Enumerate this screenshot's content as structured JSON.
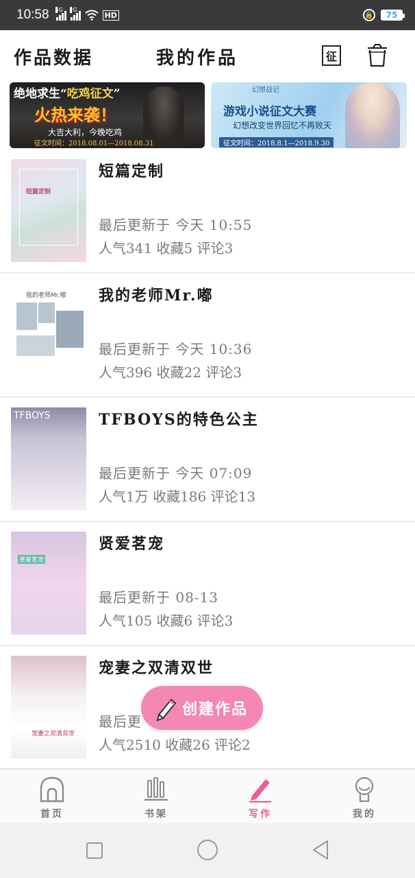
{
  "status_bar": {
    "time": "10:58",
    "net1": "4G",
    "net2": "2G",
    "hd": "HD",
    "battery": "75"
  },
  "header": {
    "left_label": "作品数据",
    "title": "我的作品",
    "contest_button": "征",
    "trash_icon": "trash-icon"
  },
  "banners": [
    {
      "headline_a": "绝地求生“",
      "headline_b": "吃鸡征文",
      "headline_c": "”",
      "big": "火热来袭！",
      "slogan": "大吉大利，今晚吃鸡",
      "date": "征文时间：2018.08.01—2018.08.31"
    },
    {
      "logo": "幻想战记",
      "title": "游戏小说征文大赛",
      "subtitle": "幻想改变世界回忆不再败天",
      "date": "征文时间：2018.8.1—2018.9.30"
    }
  ],
  "works": [
    {
      "title": "短篇定制",
      "updated": "最后更新于 今天 10:55",
      "stats": "人气341 收藏5 评论3",
      "cover_text": "短篇定制"
    },
    {
      "title": "我的老师Mr.嘟",
      "updated": "最后更新于 今天 10:36",
      "stats": "人气396 收藏22 评论3",
      "cover_text": "我的老师Mr.嘟"
    },
    {
      "title": "TFBOYS的特色公主",
      "updated": "最后更新于 今天 07:09",
      "stats": "人气1万 收藏186 评论13",
      "cover_text": "TFBOYS"
    },
    {
      "title": "贤爱茗宠",
      "updated": "最后更新于 08-13",
      "stats": "人气105 收藏6 评论3",
      "cover_text": "贤爱茗宠"
    },
    {
      "title": "宠妻之双清双世",
      "updated": "最后更",
      "stats": "人气2510 收藏26 评论2",
      "cover_text": "宠妻之双清双世"
    }
  ],
  "create_button": {
    "label": "创建作品"
  },
  "tabs": [
    {
      "label": "首页",
      "icon": "home-icon"
    },
    {
      "label": "书架",
      "icon": "bookshelf-icon"
    },
    {
      "label": "写作",
      "icon": "pen-icon",
      "active": true
    },
    {
      "label": "我的",
      "icon": "profile-icon"
    }
  ],
  "colors": {
    "accent": "#ea5f97",
    "create_button": "#f487b4",
    "status_bar": "#3a3a3a"
  }
}
